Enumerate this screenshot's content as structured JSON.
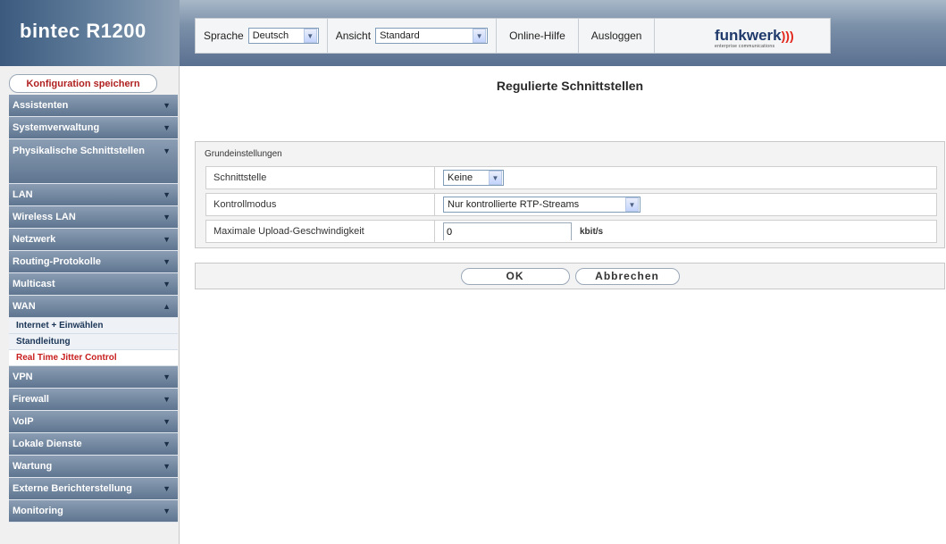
{
  "header": {
    "brand": "bintec R1200",
    "language_label": "Sprache",
    "language_value": "Deutsch",
    "view_label": "Ansicht",
    "view_value": "Standard",
    "help_link": "Online-Hilfe",
    "logout_link": "Ausloggen",
    "logo_text": "funkwerk",
    "logo_sub": "enterprise communications"
  },
  "sidebar": {
    "save_label": "Konfiguration speichern",
    "items": [
      {
        "label": "Assistenten"
      },
      {
        "label": "Systemverwaltung"
      },
      {
        "label": "Physikalische Schnittstellen"
      },
      {
        "label": "LAN"
      },
      {
        "label": "Wireless LAN"
      },
      {
        "label": "Netzwerk"
      },
      {
        "label": "Routing-Protokolle"
      },
      {
        "label": "Multicast"
      },
      {
        "label": "WAN",
        "subitems": [
          "Internet + Einwählen",
          "Standleitung",
          "Real Time Jitter Control"
        ]
      },
      {
        "label": "VPN"
      },
      {
        "label": "Firewall"
      },
      {
        "label": "VoIP"
      },
      {
        "label": "Lokale Dienste"
      },
      {
        "label": "Wartung"
      },
      {
        "label": "Externe Berichterstellung"
      },
      {
        "label": "Monitoring"
      }
    ]
  },
  "main": {
    "title": "Regulierte Schnittstellen",
    "legend": "Grundeinstellungen",
    "rows": [
      {
        "label": "Schnittstelle",
        "value": "Keine"
      },
      {
        "label": "Kontrollmodus",
        "value": "Nur kontrollierte RTP-Streams"
      },
      {
        "label": "Maximale Upload-Geschwindigkeit",
        "value": "0",
        "unit": "kbit/s"
      }
    ],
    "ok_label": "OK",
    "cancel_label": "Abbrechen"
  }
}
